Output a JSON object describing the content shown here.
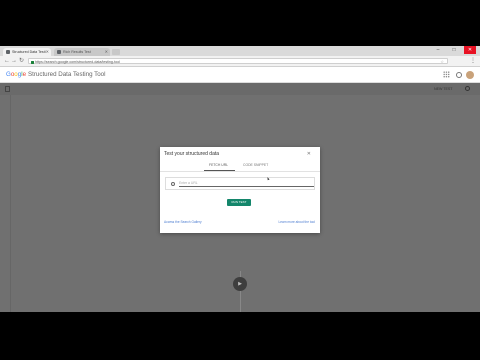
{
  "browser": {
    "tabs": [
      {
        "label": "Structured Data Testi",
        "active": true
      },
      {
        "label": "Rich Results Test",
        "active": false
      }
    ],
    "url": "https://search.google.com/structured-data/testing-tool",
    "window_controls": {
      "minimize": "–",
      "maximize": "□",
      "close": "✕"
    }
  },
  "app": {
    "logo": {
      "g": "G",
      "o1": "o",
      "o2": "o",
      "g2": "g",
      "l": "l",
      "e": "e"
    },
    "title": "Structured Data Testing Tool",
    "new_test_label": "NEW TEST"
  },
  "dialog": {
    "title": "Test your structured data",
    "close": "✕",
    "tabs": [
      "FETCH URL",
      "CODE SNIPPET"
    ],
    "url_placeholder": "Enter a URL",
    "run_button": "RUN TEST",
    "link_left": "Access the Search Gallery",
    "link_right": "Learn more about the tool"
  },
  "fab": {
    "symbol": "▶"
  },
  "colors": {
    "accent": "#14866b",
    "overlay": "#707070",
    "link": "#4a7bd0"
  }
}
